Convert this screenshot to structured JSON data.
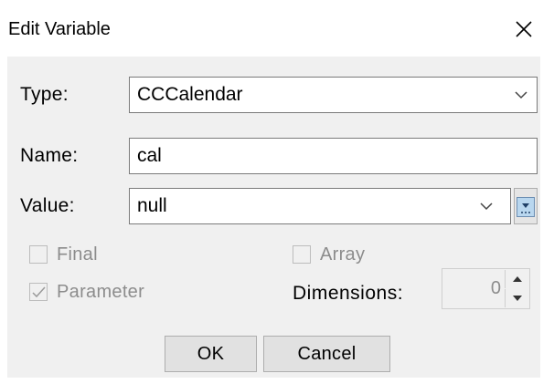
{
  "dialog": {
    "title": "Edit Variable"
  },
  "form": {
    "type_label": "Type:",
    "type_value": "CCCalendar",
    "name_label": "Name:",
    "name_value": "cal",
    "value_label": "Value:",
    "value_value": "null"
  },
  "options": {
    "final_label": "Final",
    "final_checked": false,
    "array_label": "Array",
    "array_checked": false,
    "parameter_label": "Parameter",
    "parameter_checked": true,
    "dimensions_label": "Dimensions:",
    "dimensions_value": "0"
  },
  "buttons": {
    "ok_label": "OK",
    "cancel_label": "Cancel"
  },
  "icons": {
    "close": "close-icon",
    "combo_arrow": "chevron-down-icon",
    "browse": "dropdown-browse-icon",
    "spin_up": "triangle-up-icon",
    "spin_down": "triangle-down-icon",
    "check": "checkmark-icon"
  },
  "colors": {
    "window_bg": "#f0f0f0",
    "title_bg": "#ffffff",
    "disabled_text": "#8c8c8c",
    "button_bg": "#e1e1e1",
    "accent": "#b9d7ef"
  }
}
